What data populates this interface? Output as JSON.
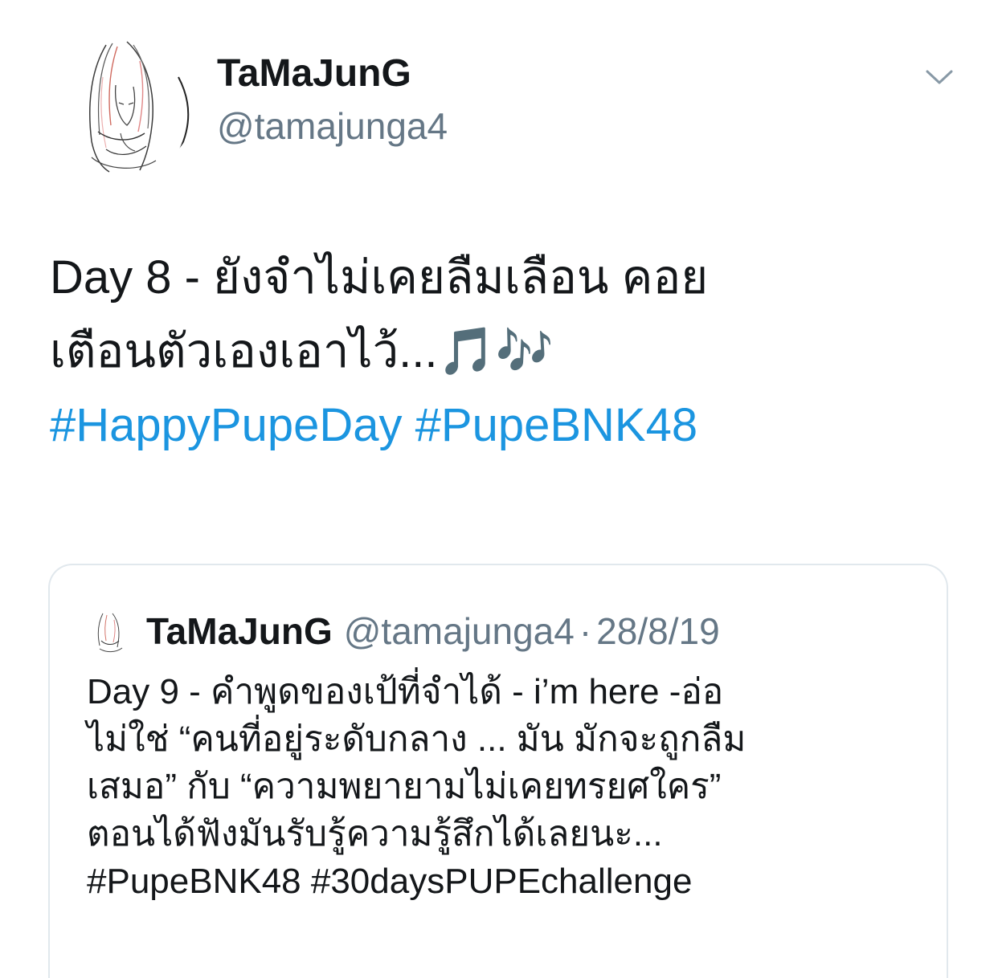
{
  "tweet": {
    "author": {
      "display_name": "TaMaJunG",
      "handle": "@tamajunga4",
      "avatar_icon": "sketch-portrait-avatar"
    },
    "menu_icon": "chevron-down-icon",
    "text_lines": [
      "Day 8 - ยังจำไม่เคยลืมเลือน คอย",
      "เตือนตัวเองเอาไว้...🎵🎶"
    ],
    "hashtags": [
      "#HappyPupeDay",
      "#PupeBNK48"
    ],
    "hashtag_color": "#1b95e0"
  },
  "quoted_tweet": {
    "author": {
      "display_name": "TaMaJunG",
      "handle": "@tamajunga4",
      "avatar_icon": "sketch-portrait-avatar"
    },
    "separator": "·",
    "date": "28/8/19",
    "text_lines": [
      "Day 9 - คำพูดของเป้ที่จำได้ - i’m here -อ่อ",
      "ไม่ใช่ “คนที่อยู่ระดับกลาง ... มัน มักจะถูกลืม",
      "เสมอ” กับ “ความพยายามไม่เคยทรยศใคร”",
      "ตอนได้ฟังมันรับรู้ความรู้สึกได้เลยนะ...",
      "#PupeBNK48 #30daysPUPEchallenge"
    ]
  },
  "colors": {
    "text_primary": "#14171a",
    "text_secondary": "#657786",
    "border": "#e1e8ed",
    "link": "#1b95e0"
  }
}
